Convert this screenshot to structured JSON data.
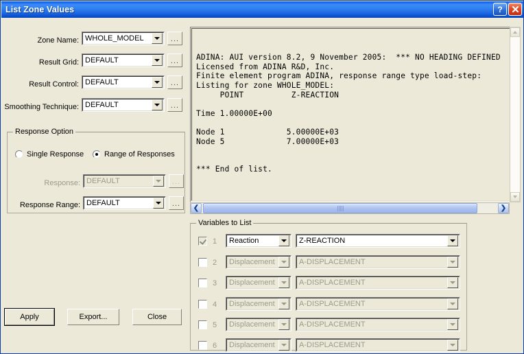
{
  "window": {
    "title": "List Zone Values",
    "help_button": "?",
    "close_button": "✕"
  },
  "form": {
    "fields": [
      {
        "label": "Zone Name:",
        "value": "WHOLE_MODEL",
        "dots": "...",
        "disabled": false
      },
      {
        "label": "Result Grid:",
        "value": "DEFAULT",
        "dots": "...",
        "disabled": false
      },
      {
        "label": "Result Control:",
        "value": "DEFAULT",
        "dots": "...",
        "disabled": false
      },
      {
        "label": "Smoothing Technique:",
        "value": "DEFAULT",
        "dots": "...",
        "disabled": false
      }
    ]
  },
  "response_option": {
    "legend": "Response Option",
    "radios": [
      {
        "label": "Single Response",
        "selected": false
      },
      {
        "label": "Range of Responses",
        "selected": true
      }
    ],
    "response": {
      "label": "Response:",
      "value": "DEFAULT",
      "dots": "...",
      "disabled": true
    },
    "response_range": {
      "label": "Response Range:",
      "value": "DEFAULT",
      "dots": "...",
      "disabled": false
    }
  },
  "listing": {
    "text": "ADINA: AUI version 8.2, 9 November 2005:  *** NO HEADING DEFINED\nLicensed from ADINA R&D, Inc.\nFinite element program ADINA, response range type load-step:\nListing for zone WHOLE_MODEL:\n     POINT          Z-REACTION\n\nTime 1.00000E+00\n\nNode 1             5.00000E+03\nNode 5             7.00000E+03\n\n\n*** End of list."
  },
  "variables": {
    "legend": "Variables to List",
    "rows": [
      {
        "num": "1",
        "checked": true,
        "disabled": false,
        "type": "Reaction",
        "variable": "Z-REACTION"
      },
      {
        "num": "2",
        "checked": false,
        "disabled": true,
        "type": "Displacement",
        "variable": "A-DISPLACEMENT"
      },
      {
        "num": "3",
        "checked": false,
        "disabled": true,
        "type": "Displacement",
        "variable": "A-DISPLACEMENT"
      },
      {
        "num": "4",
        "checked": false,
        "disabled": true,
        "type": "Displacement",
        "variable": "A-DISPLACEMENT"
      },
      {
        "num": "5",
        "checked": false,
        "disabled": true,
        "type": "Displacement",
        "variable": "A-DISPLACEMENT"
      },
      {
        "num": "6",
        "checked": false,
        "disabled": true,
        "type": "Displacement",
        "variable": "A-DISPLACEMENT"
      }
    ]
  },
  "buttons": {
    "apply": "Apply",
    "export": "Export...",
    "close": "Close"
  },
  "colors": {
    "dialog_face": "#ece9d8",
    "title_blue": "#1f6ff0",
    "close_red": "#e04a28",
    "scrollbar_blue": "#aabfee"
  }
}
